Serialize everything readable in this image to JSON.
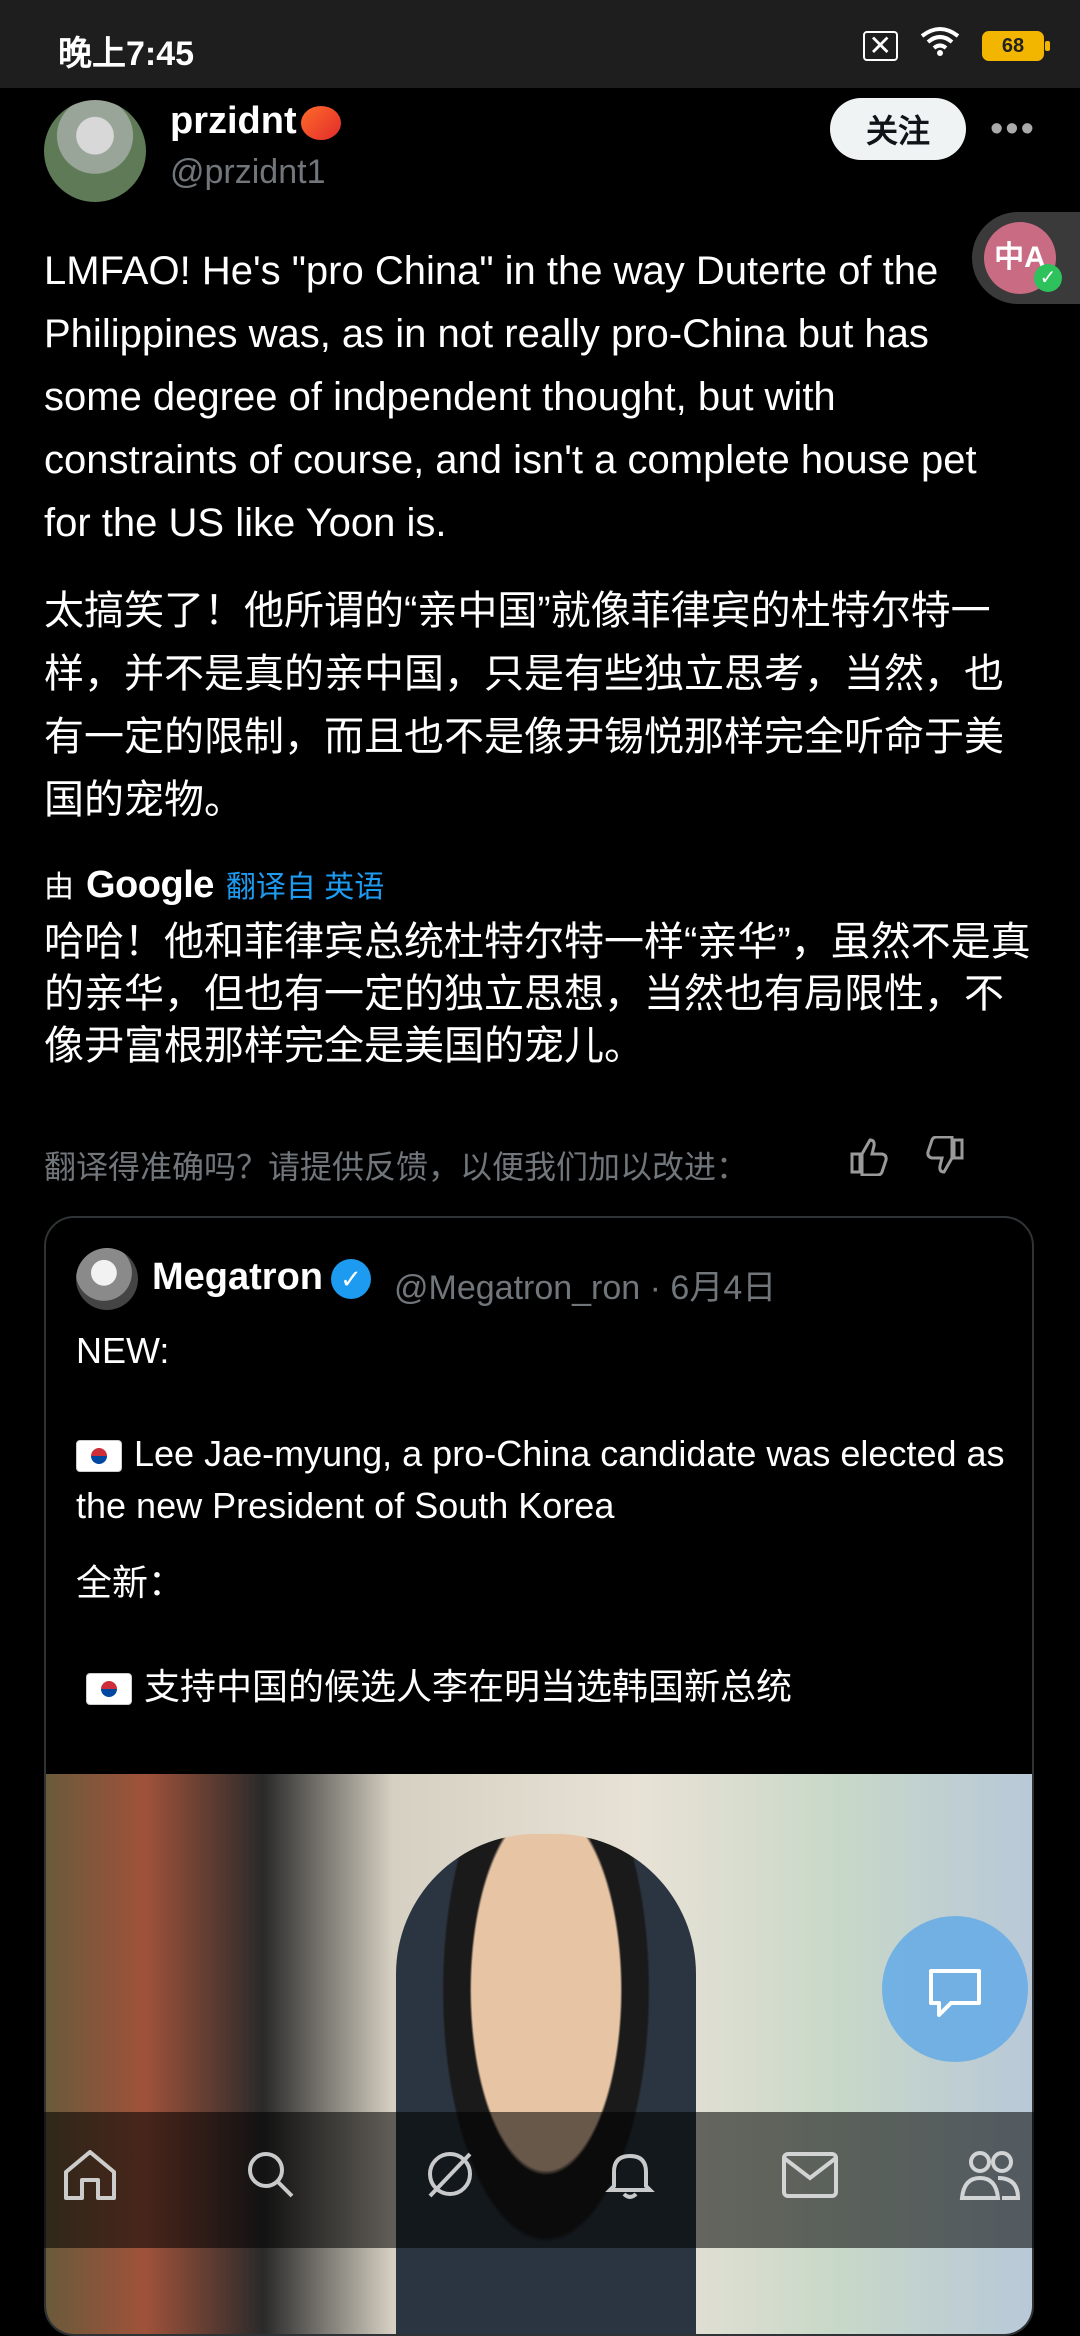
{
  "status_bar": {
    "time": "晚上7:45",
    "battery": "68",
    "icons": [
      "screen-off-icon",
      "wifi-icon",
      "battery-icon"
    ]
  },
  "post": {
    "author_name": "przidnt",
    "author_handle": "@przidnt1",
    "follow_label": "关注",
    "more_label": "•••",
    "body_en": "LMFAO! He's \"pro China\" in the way Duterte of the Philippines was, as in not really pro-China but has some degree of indpendent thought, but with constraints of course, and isn't a complete house pet for the US like Yoon is.",
    "body_zh": "太搞笑了！他所谓的“亲中国”就像菲律宾的杜特尔特一样，并不是真的亲中国，只是有些独立思考，当然，也有一定的限制，而且也不是像尹锡悦那样完全听命于美国的宠物。",
    "by_label": "由",
    "google_label": "Google",
    "translated_from": "翻译自 英语",
    "google_translation": "哈哈！他和菲律宾总统杜特尔特一样“亲华”，虽然不是真的亲华，但也有一定的独立思想，当然也有局限性，不像尹富根那样完全是美国的宠儿。",
    "feedback_prompt": "翻译得准确吗？请提供反馈，以便我们加以改进："
  },
  "translate_fab": {
    "label": "中A"
  },
  "quoted": {
    "name": "Megatron",
    "handle_date": "@Megatron_ron · 6月4日",
    "new_label": "NEW:",
    "body_en": "Lee Jae-myung, a pro-China candidate was elected as the new President of South Korea",
    "zh_label": "全新：",
    "body_zh": "支持中国的候选人李在明当选韩国新总统"
  },
  "nav": {
    "items": [
      "home-icon",
      "search-icon",
      "grok-icon",
      "notifications-icon",
      "messages-icon",
      "communities-icon"
    ]
  },
  "colors": {
    "accent": "#1d9bf0",
    "background": "#000000",
    "muted": "#71767b"
  }
}
